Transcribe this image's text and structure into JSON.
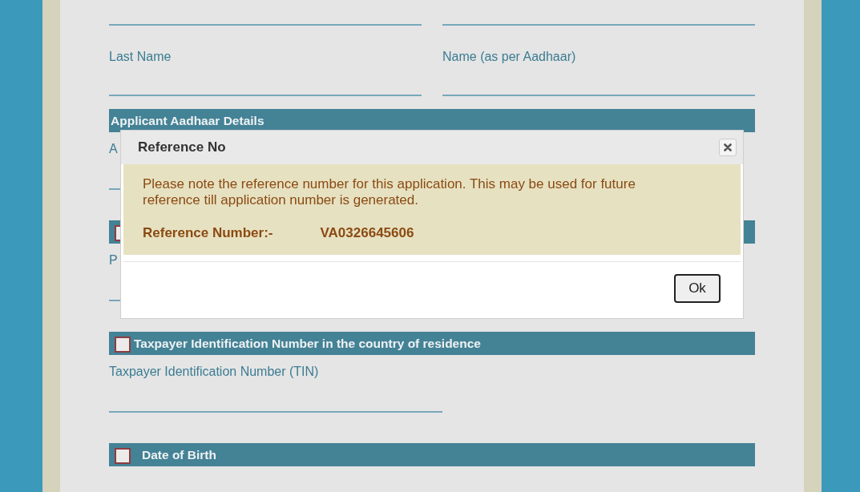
{
  "name_fields": [
    {
      "label": "Last Name"
    },
    {
      "label": "Name (as per Aadhaar)"
    }
  ],
  "sections": [
    {
      "kind": "plain",
      "title": "Applicant Aadhaar Details",
      "field_label": "A"
    },
    {
      "kind": "checkbox",
      "checked": false,
      "field_label": "P"
    },
    {
      "kind": "checkbox",
      "checked": false,
      "title": "Taxpayer Identification Number in the country of residence",
      "field_label": "Taxpayer Identification Number (TIN)"
    },
    {
      "kind": "checkbox",
      "checked": false,
      "title": "Date of Birth"
    }
  ],
  "dialog": {
    "title": "Reference No",
    "message": "Please note the reference number for this application. This may be used for future reference till application number is generated.",
    "reference_label": "Reference Number:-",
    "reference_value": "VA0326645606",
    "ok_button": "Ok"
  }
}
